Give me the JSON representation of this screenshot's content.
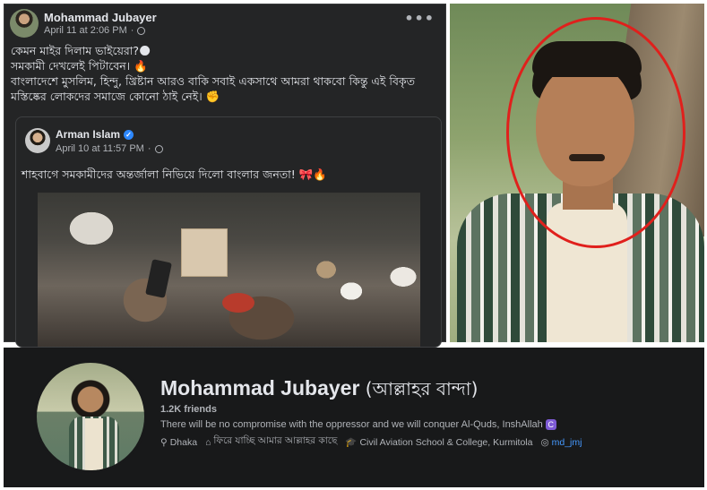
{
  "post": {
    "author": "Mohammad Jubayer",
    "timestamp": "April 11 at 2:06 PM",
    "more_icon": "•••",
    "text_lines": [
      "কেমন মাইর দিলাম ভাইয়েরা?🌑",
      "সমকামী দেখলেই পিটাবেন। 🔥",
      "বাংলাদেশে মুসলিম, হিন্দু, খ্রিষ্টান আরও বাকি সবাই একসাথে আমরা থাকবো কিন্তু এই বিকৃত",
      "মস্তিষ্কের লোকদের সমাজে কোনো ঠাই নেই। ✊"
    ]
  },
  "shared_post": {
    "author": "Arman Islam",
    "verified_icon": "✓",
    "timestamp": "April 10 at 11:57 PM",
    "text": "শাহবাগে সমকামীদের অন্তর্জালা নিভিয়ে দিলো বাংলার জনতা! 🎀🔥"
  },
  "profile": {
    "name": "Mohammad Jubayer",
    "alt_name": "(আল্লাহর বান্দা)",
    "friends": "1.2K friends",
    "bio": "There will be no compromise with the oppressor and we will conquer Al-Quds, InshAllah",
    "bio_badge": "C",
    "location": "Dhaka",
    "status": "ফিরে যাচ্ছি আমার আল্লাহর কাছে",
    "school": "Civil Aviation School & College, Kurmitola",
    "instagram": "md_jmj"
  },
  "icons": {
    "location": "⚲",
    "home": "⌂",
    "school": "🎓",
    "instagram": "◎"
  },
  "colors": {
    "panel_bg": "#242526",
    "profile_bg": "#18191a",
    "highlight_ring": "#e0201c",
    "link": "#4599ff"
  }
}
